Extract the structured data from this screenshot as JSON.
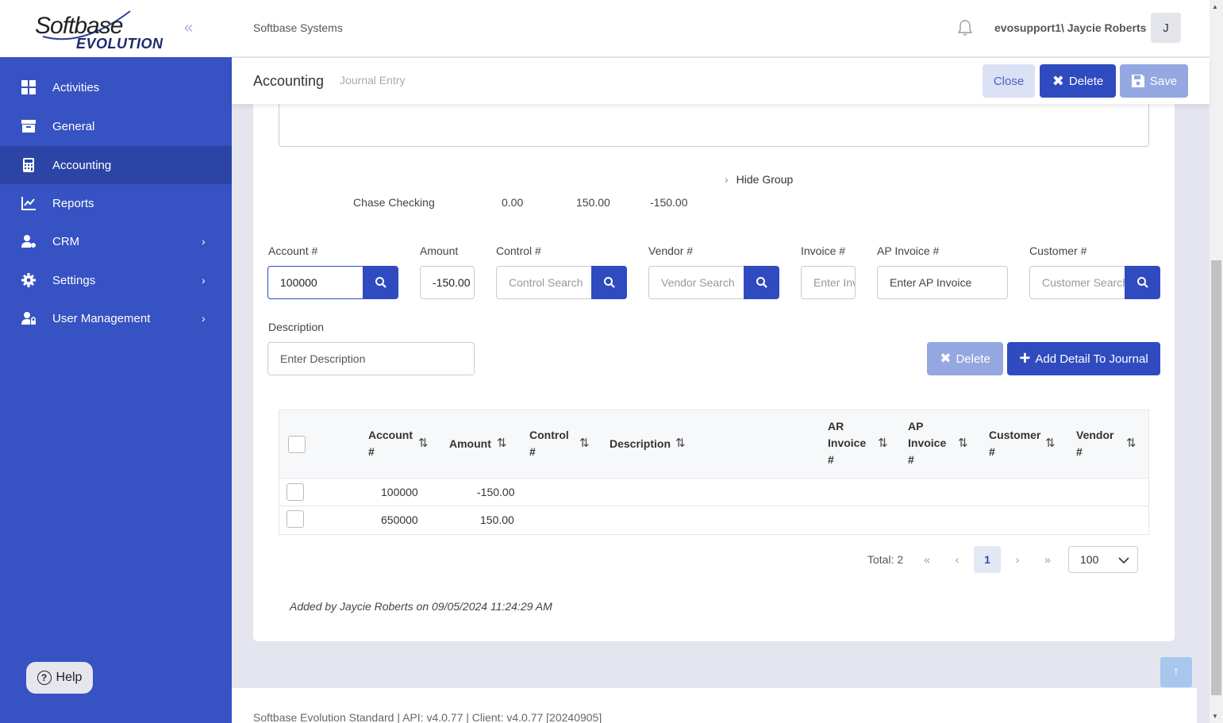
{
  "brand": {
    "logo_top": "Softbase",
    "logo_bottom": "EVOLUTION",
    "collapse_glyph": "«"
  },
  "sidebar": {
    "items": [
      {
        "label": "Activities",
        "icon": "grid-icon"
      },
      {
        "label": "General",
        "icon": "archive-icon"
      },
      {
        "label": "Accounting",
        "icon": "calculator-icon",
        "active": true
      },
      {
        "label": "Reports",
        "icon": "chart-icon"
      },
      {
        "label": "CRM",
        "icon": "user-cog-icon",
        "has_children": true
      },
      {
        "label": "Settings",
        "icon": "gear-icon",
        "has_children": true
      },
      {
        "label": "User Management",
        "icon": "user-lock-icon",
        "has_children": true
      }
    ],
    "help_label": "Help"
  },
  "header": {
    "company": "Softbase Systems",
    "user": "evosupport1\\ Jaycie Roberts",
    "avatar_initial": "J"
  },
  "subheader": {
    "title": "Accounting",
    "subtitle": "Journal Entry",
    "close_label": "Close",
    "delete_label": "Delete",
    "save_label": "Save"
  },
  "group": {
    "toggle_label": "Hide Group",
    "name": "Chase Checking",
    "debit": "0.00",
    "credit": "150.00",
    "net": "-150.00"
  },
  "form": {
    "account_label": "Account #",
    "account_value": "100000",
    "amount_label": "Amount",
    "amount_value": "-150.00",
    "control_label": "Control #",
    "control_placeholder": "Control Search",
    "vendor_label": "Vendor #",
    "vendor_placeholder": "Vendor Search",
    "invoice_label": "Invoice #",
    "invoice_placeholder": "Enter Invoice",
    "ap_invoice_label": "AP Invoice #",
    "ap_invoice_placeholder": "Enter AP Invoice",
    "customer_label": "Customer #",
    "customer_placeholder": "Customer Search",
    "description_label": "Description",
    "description_placeholder": "Enter Description",
    "delete_label": "Delete",
    "add_label": "Add Detail To Journal"
  },
  "table": {
    "columns": {
      "account": [
        "Account",
        "#"
      ],
      "amount": [
        "Amount"
      ],
      "control": [
        "Control",
        "#"
      ],
      "description": [
        "Description"
      ],
      "ar_invoice": [
        "AR",
        "Invoice",
        "#"
      ],
      "ap_invoice": [
        "AP",
        "Invoice",
        "#"
      ],
      "customer": [
        "Customer",
        "#"
      ],
      "vendor": [
        "Vendor",
        "#"
      ]
    },
    "rows": [
      {
        "account": "100000",
        "amount": "-150.00"
      },
      {
        "account": "650000",
        "amount": "150.00"
      }
    ]
  },
  "pagination": {
    "total_label": "Total: 2",
    "first": "«",
    "prev": "‹",
    "current": "1",
    "next": "›",
    "last": "»",
    "page_size": "100"
  },
  "audit": {
    "text": "Added by  Jaycie Roberts on 09/05/2024 11:24:29 AM"
  },
  "footer": {
    "text": "Softbase Evolution Standard | API: v4.0.77 | Client: v4.0.77 [20240905]"
  },
  "colors": {
    "sidebar": "#3752c2",
    "sidebar_active": "#2b44a5",
    "primary": "#2f4bbf",
    "disabled_primary": "#95a7e0"
  }
}
